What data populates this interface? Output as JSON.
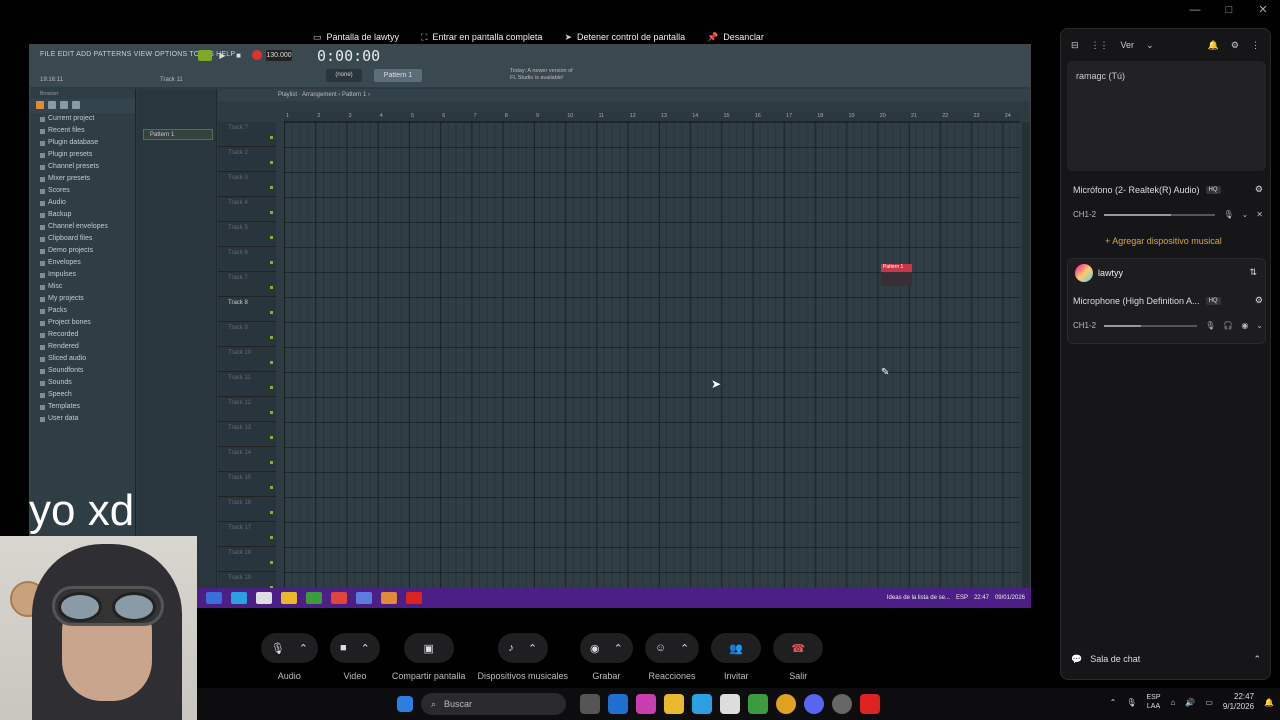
{
  "window": {
    "minimize": "—",
    "maximize": "□",
    "close": "✕"
  },
  "share_bar": {
    "items": [
      {
        "label": "Pantalla de lawtyy",
        "icon": "screen-icon"
      },
      {
        "label": "Entrar en pantalla completa",
        "icon": "fullscreen-icon"
      },
      {
        "label": "Detener control de pantalla",
        "icon": "cursor-icon"
      },
      {
        "label": "Desanclar",
        "icon": "pin-icon"
      }
    ]
  },
  "fl": {
    "menu": "FILE  EDIT  ADD  PATTERNS  VIEW  OPTIONS  TOOLS  HELP",
    "time": "19:16:11",
    "track": "Track 11",
    "tempo": "130.000",
    "timer": "0:00:00",
    "none": "(none)",
    "pattern": "Pattern 1",
    "news": "Today: A newer version of FL Studio is available!",
    "browser_title": "Browser",
    "browser_items": [
      "Current project",
      "Recent files",
      "Plugin database",
      "Plugin presets",
      "Channel presets",
      "Mixer presets",
      "Scores",
      "Audio",
      "Backup",
      "Channel envelopes",
      "Clipboard files",
      "Demo projects",
      "Envelopes",
      "Impulses",
      "Misc",
      "My projects",
      "Packs",
      "Project bones",
      "Recorded",
      "Rendered",
      "Sliced audio",
      "Soundfonts",
      "Sounds",
      "Speech",
      "Templates",
      "User data"
    ],
    "channel_pattern": "Pattern 1",
    "playlist_title": "Playlist · Arrangement › Pattern 1 ›",
    "ruler": [
      "1",
      "2",
      "3",
      "4",
      "5",
      "6",
      "7",
      "8",
      "9",
      "10",
      "11",
      "12",
      "13",
      "14",
      "15",
      "16",
      "17",
      "18",
      "19",
      "20",
      "21",
      "22",
      "23",
      "24"
    ],
    "tracks": [
      "Track 7",
      "Track 2",
      "Track 3",
      "Track 4",
      "Track 5",
      "Track 6",
      "Track 7",
      "Track 8",
      "Track 9",
      "Track 10",
      "Track 11",
      "Track 12",
      "Track 13",
      "Track 14",
      "Track 15",
      "Track 16",
      "Track 17",
      "Track 18",
      "Track 19"
    ],
    "clip": "Pattern 1"
  },
  "inner_taskbar": {
    "notification": "Ideas de la lista de se...",
    "lang": "ESP",
    "time": "22:47",
    "date": "09/01/2026"
  },
  "overlay_text": "yo xd",
  "call_controls": [
    {
      "label": "Audio",
      "icon": "mic-icon"
    },
    {
      "label": "Video",
      "icon": "camera-icon"
    },
    {
      "label": "Compartir pantalla",
      "icon": "share-screen-icon"
    },
    {
      "label": "Dispositivos musicales",
      "icon": "music-note-icon"
    },
    {
      "label": "Grabar",
      "icon": "record-icon"
    },
    {
      "label": "Reacciones",
      "icon": "emoji-icon"
    },
    {
      "label": "Invitar",
      "icon": "people-icon"
    },
    {
      "label": "Salir",
      "icon": "hangup-icon"
    }
  ],
  "panel": {
    "view": "Ver",
    "self_name": "ramagc (Tú)",
    "mic1": "Micrófono (2- Realtek(R) Audio)",
    "hq": "HQ",
    "ch": "CH1-2",
    "add_device": "+ Agregar dispositivo musical",
    "user": "lawtyy",
    "mic2": "Microphone (High Definition A...",
    "chat": "Sala de chat",
    "mic1_level": 0.6,
    "mic2_level": 0.4
  },
  "taskbar": {
    "search": "Buscar",
    "lang1": "ESP",
    "lang2": "LAA",
    "time": "22:47",
    "date": "9/1/2026"
  },
  "colors": {
    "accent": "#d4a843",
    "fl_clip": "#c93545",
    "hangup": "#e05a5a",
    "inner_taskbar": "#4b1f85"
  }
}
